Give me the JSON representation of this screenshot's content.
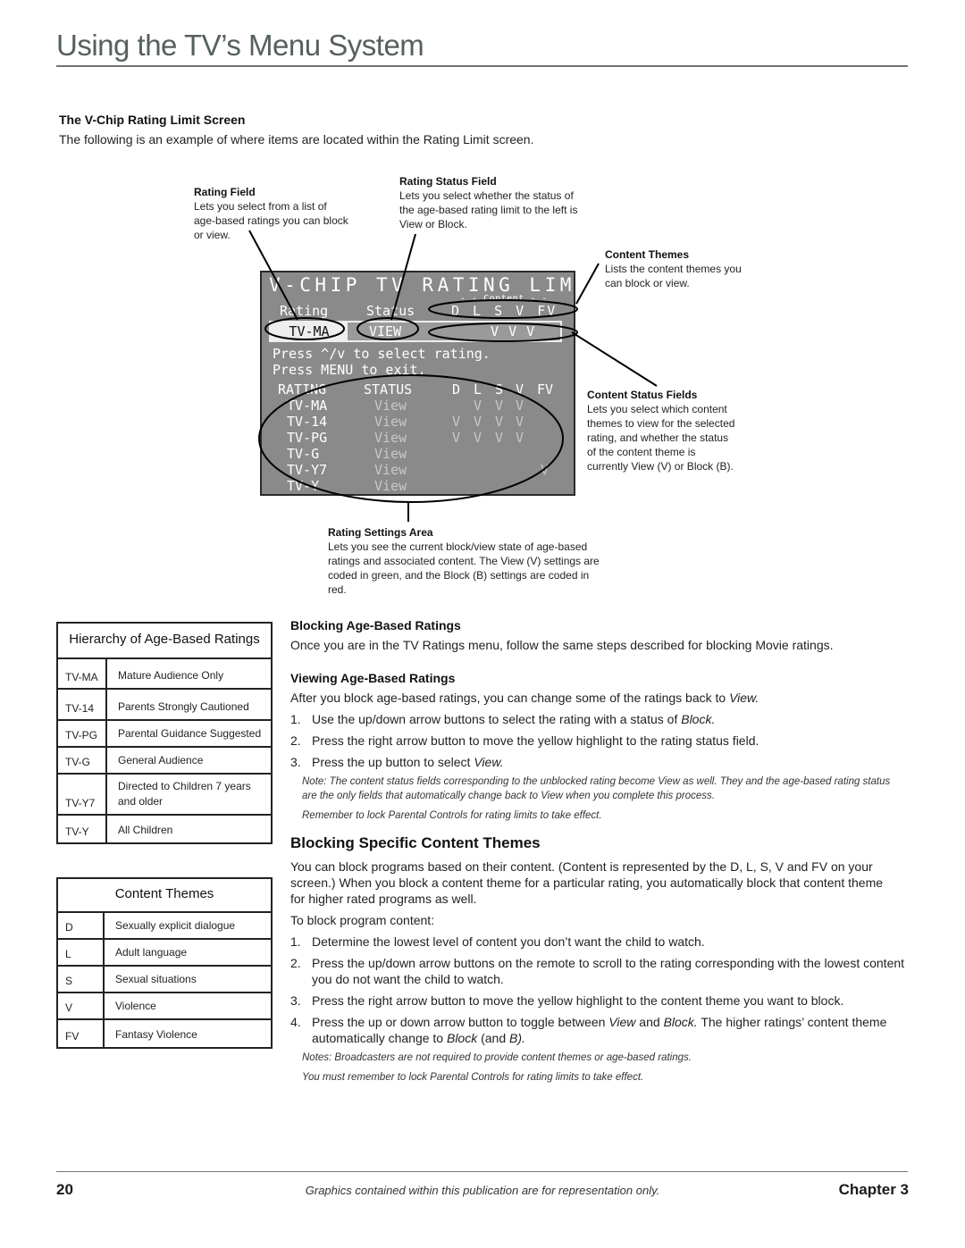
{
  "header": {
    "title": "Using the TV’s Menu System"
  },
  "intro": {
    "heading": "The V-Chip Rating Limit Screen",
    "text": "The following is an example of where items are located within the Rating Limit screen."
  },
  "callouts": {
    "rating_field": {
      "title": "Rating Field",
      "lines": [
        "Lets you select from a list of",
        "age-based ratings you can block",
        "or view."
      ]
    },
    "rating_status_field": {
      "title": "Rating Status Field",
      "lines": [
        "Lets you select whether the status of",
        "the age-based rating limit to the left is",
        "View or Block."
      ]
    },
    "content_themes": {
      "title": "Content Themes",
      "lines": [
        "Lists the content themes you",
        "can block or view."
      ]
    },
    "content_status_fields": {
      "title": "Content Status Fields",
      "lines": [
        "Lets you select which content",
        "themes to view for the selected",
        "rating, and whether the status",
        "of the content theme is",
        "currently View (V) or Block (B)."
      ]
    },
    "rating_settings_area": {
      "title": "Rating Settings Area",
      "lines": [
        "Lets you see the current block/view state of age-based",
        "ratings and associated content. The View (V) settings are",
        "coded in green, and the Block (B) settings are coded in",
        "red."
      ]
    }
  },
  "tv_screen": {
    "title": "V-CHIP TV RATING LIMIT",
    "content_label": "- - Content - -",
    "header_rating": "Rating",
    "header_status": "Status",
    "header_content": "D L S V FV",
    "selected_rating": "TV-MA",
    "selected_status": "VIEW",
    "selected_content": "  V V V",
    "instruction_1": "Press ^/v to select rating.",
    "instruction_2": "Press MENU to exit.",
    "col_rating": "RATING",
    "col_status": "STATUS",
    "col_content": [
      "D",
      "L",
      "S",
      "V",
      "FV"
    ],
    "rows": [
      {
        "rating": "TV-MA",
        "status": "View",
        "content": [
          "",
          "V",
          "V",
          "V",
          ""
        ]
      },
      {
        "rating": "TV-14",
        "status": "View",
        "content": [
          "V",
          "V",
          "V",
          "V",
          ""
        ]
      },
      {
        "rating": "TV-PG",
        "status": "View",
        "content": [
          "V",
          "V",
          "V",
          "V",
          ""
        ]
      },
      {
        "rating": "TV-G",
        "status": "View",
        "content": [
          "",
          "",
          "",
          "",
          ""
        ]
      },
      {
        "rating": "TV-Y7",
        "status": "View",
        "content": [
          "",
          "",
          "",
          "",
          "V"
        ]
      },
      {
        "rating": "TV-Y",
        "status": "View",
        "content": [
          "",
          "",
          "",
          "",
          ""
        ]
      }
    ],
    "colors": {
      "background": "#8a8a8a",
      "text": "#ffffff",
      "dim_text": "#c8c8c8"
    }
  },
  "hierarchy_table": {
    "title": "Hierarchy of Age-Based Ratings",
    "rows": [
      {
        "code": "TV-MA",
        "desc": "Mature Audience Only"
      },
      {
        "code": "TV-14",
        "desc": "Parents Strongly Cautioned"
      },
      {
        "code": "TV-PG",
        "desc": "Parental Guidance Suggested"
      },
      {
        "code": "TV-G",
        "desc": "General Audience"
      },
      {
        "code": "TV-Y7",
        "desc": "Directed to Children 7 years and older"
      },
      {
        "code": "TV-Y",
        "desc": "All Children"
      }
    ]
  },
  "content_themes_table": {
    "title": "Content Themes",
    "rows": [
      {
        "code": "D",
        "desc": "Sexually explicit dialogue"
      },
      {
        "code": "L",
        "desc": "Adult language"
      },
      {
        "code": "S",
        "desc": "Sexual situations"
      },
      {
        "code": "V",
        "desc": "Violence"
      },
      {
        "code": "FV",
        "desc": "Fantasy Violence"
      }
    ]
  },
  "blocking_age": {
    "heading": "Blocking Age-Based Ratings",
    "text": "Once you are in the TV Ratings menu, follow the same steps described for blocking Movie ratings."
  },
  "viewing_age": {
    "heading": "Viewing Age-Based Ratings",
    "intro_pre": "After you block age-based ratings, you can change some of the ratings back to ",
    "intro_em": "View.",
    "steps": [
      {
        "num": "1.",
        "pre": "Use the up/down arrow buttons to select the rating with a status of ",
        "em": "Block.",
        "post": ""
      },
      {
        "num": "2.",
        "pre": "Press the right arrow button to move the yellow highlight to the rating status field.",
        "em": "",
        "post": ""
      },
      {
        "num": "3.",
        "pre": "Press the up button to select ",
        "em": "View.",
        "post": ""
      }
    ],
    "note": "Note:  The content status fields corresponding to the unblocked rating become View as well. They and the age-based rating status are the only fields that automatically change back to View when you complete this process.",
    "reminder": "Remember to lock Parental Controls for rating limits to take effect."
  },
  "blocking_content": {
    "heading": "Blocking Specific Content Themes",
    "text": "You can block programs based on their content. (Content is represented by the D, L, S, V and FV on your screen.) When you block a content theme for a particular rating, you automatically block that content theme for higher rated programs as well.",
    "lead": "To block program content:",
    "steps": [
      {
        "num": "1.",
        "text": "Determine the lowest level of content you don’t want the child to watch."
      },
      {
        "num": "2.",
        "text": "Press the up/down arrow buttons on the remote to scroll to the rating corresponding with the lowest content you do not want the child to watch."
      },
      {
        "num": "3.",
        "text": "Press the right arrow button to move the yellow highlight to the content theme you want to block."
      }
    ],
    "step4": {
      "num": "4.",
      "a": "Press the up or down arrow button to toggle between ",
      "b": "View",
      "c": " and ",
      "d": "Block.",
      "e": " The higher ratings’ content theme automatically change to ",
      "f": "Block",
      "g": " (and ",
      "h": "B).",
      "i": ""
    },
    "note1": "Notes:  Broadcasters are not required to provide content themes or age-based ratings.",
    "note2": "You must remember to lock Parental Controls for rating limits to take effect."
  },
  "footer": {
    "page_number": "20",
    "note": "Graphics contained within this publication are for representation only.",
    "chapter": "Chapter 3"
  }
}
